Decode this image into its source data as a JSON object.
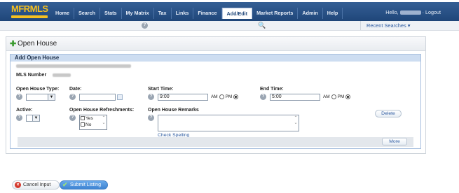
{
  "nav": {
    "logo_text": "MFRMLS",
    "tabs": [
      "Home",
      "Search",
      "Stats",
      "My Matrix",
      "Tax",
      "Links",
      "Finance",
      "Add/Edit",
      "Market Reports",
      "Admin",
      "Help"
    ],
    "active_tab": "Add/Edit",
    "hello": "Hello,",
    "logout": "· Logout"
  },
  "subbar": {
    "help": "?",
    "recent_searches": "Recent Searches"
  },
  "panel": {
    "title": "Open House",
    "section_title": "Add Open House",
    "mls_label": "MLS Number"
  },
  "form": {
    "help_glyph": "?",
    "open_house_type_label": "Open House Type:",
    "date_label": "Date:",
    "start_time_label": "Start Time:",
    "start_time_value": "9:00",
    "end_time_label": "End Time:",
    "end_time_value": "5:00",
    "am": "AM",
    "pm": "PM",
    "start_pm_selected": true,
    "end_pm_selected": true,
    "active_label": "Active:",
    "refreshments_label": "Open House Refreshments:",
    "refreshments_options": [
      "Yes",
      "No"
    ],
    "remarks_label": "Open House Remarks",
    "check_spelling": "Check Spelling",
    "delete_button": "Delete",
    "more_button": "More"
  },
  "actions": {
    "cancel": "Cancel Input",
    "submit": "Submit Listing"
  },
  "colors": {
    "nav_bg": "#1f4679",
    "section_header": "#cdddf1",
    "submit_bg": "#3f84d2",
    "cancel_icon": "#d53a2e"
  }
}
